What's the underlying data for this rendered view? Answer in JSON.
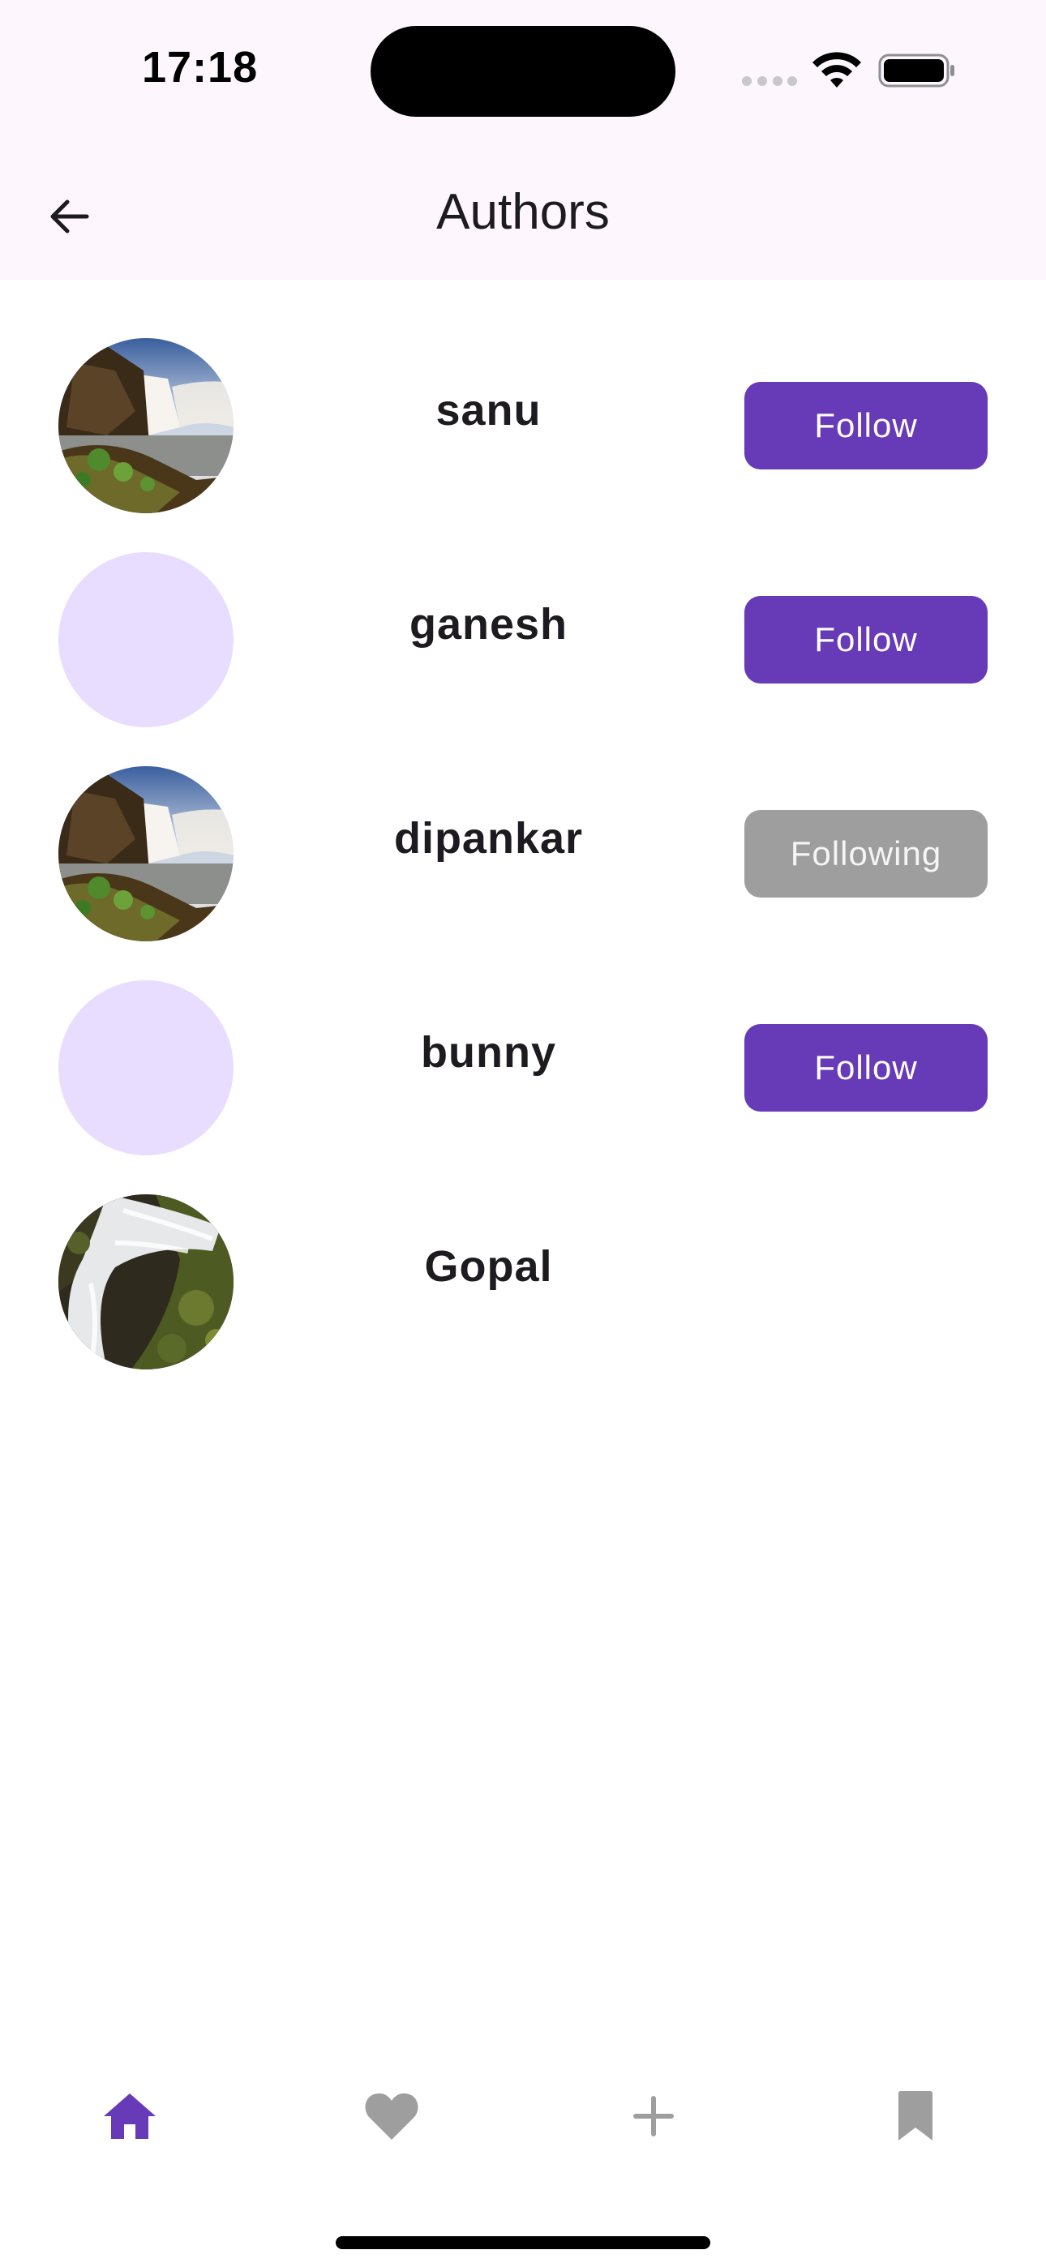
{
  "status_bar": {
    "time": "17:18"
  },
  "app_bar": {
    "title": "Authors",
    "back_icon": "arrow-left-icon"
  },
  "authors": [
    {
      "name": "sanu",
      "avatar": "waterfall-photo",
      "button": "Follow",
      "following": false
    },
    {
      "name": "ganesh",
      "avatar": "empty-placeholder",
      "button": "Follow",
      "following": false
    },
    {
      "name": "dipankar",
      "avatar": "waterfall-photo",
      "button": "Following",
      "following": true
    },
    {
      "name": "bunny",
      "avatar": "empty-placeholder",
      "button": "Follow",
      "following": false
    },
    {
      "name": "Gopal",
      "avatar": "cascade-photo",
      "button": "",
      "following": false
    }
  ],
  "bottom_nav": {
    "items": [
      "home-icon",
      "heart-icon",
      "add-icon",
      "bookmark-icon"
    ],
    "active": "home-icon"
  },
  "colors": {
    "accent": "#673ab7",
    "following": "#9e9e9e",
    "avatar_placeholder": "#e9ddff",
    "app_bar_bg": "#fdf6fd",
    "nav_inactive": "#9e9e9e"
  }
}
